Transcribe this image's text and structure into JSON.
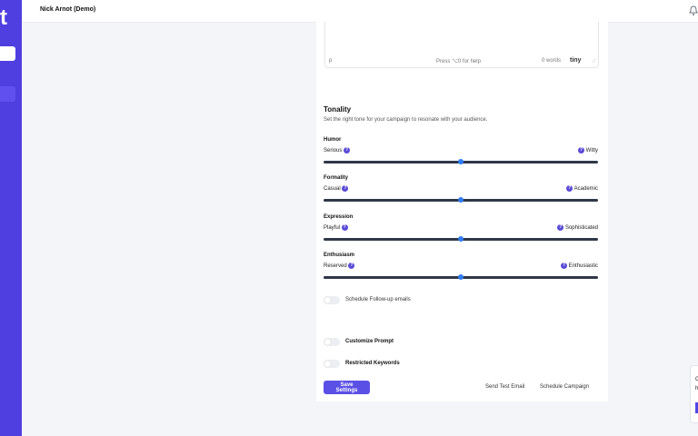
{
  "sidebar": {
    "logo_text": "t"
  },
  "header": {
    "user_name": "Nick Arnot (Demo)",
    "notification_icon": "bell-icon"
  },
  "editor": {
    "path": "p",
    "help": "Press ⌥0 for help",
    "words": "0 words",
    "brand": "tiny"
  },
  "tonality": {
    "title": "Tonality",
    "description": "Set the right tone for your campaign to resonate with your audience.",
    "sliders": [
      {
        "label": "Humor",
        "left": "Serious",
        "right": "Witty",
        "value": 50
      },
      {
        "label": "Formality",
        "left": "Casual",
        "right": "Academic",
        "value": 50
      },
      {
        "label": "Expression",
        "left": "Playful",
        "right": "Sophisticated",
        "value": 50
      },
      {
        "label": "Enthusiasm",
        "left": "Reserved",
        "right": "Enthusiastic",
        "value": 50
      }
    ]
  },
  "toggles": {
    "followup": "Schedule Follow-up emails",
    "customize_prompt": "Customize Prompt",
    "restricted_keywords": "Restricted Keywords"
  },
  "actions": {
    "save": "Save Settings",
    "test_email": "Send Test Email",
    "schedule": "Schedule Campaign"
  },
  "chat": {
    "line1": "C",
    "line2": "h"
  },
  "colors": {
    "accent": "#4f3fe0",
    "slider_thumb": "#2f7cf6",
    "help_icon": "#5b4bd6"
  }
}
